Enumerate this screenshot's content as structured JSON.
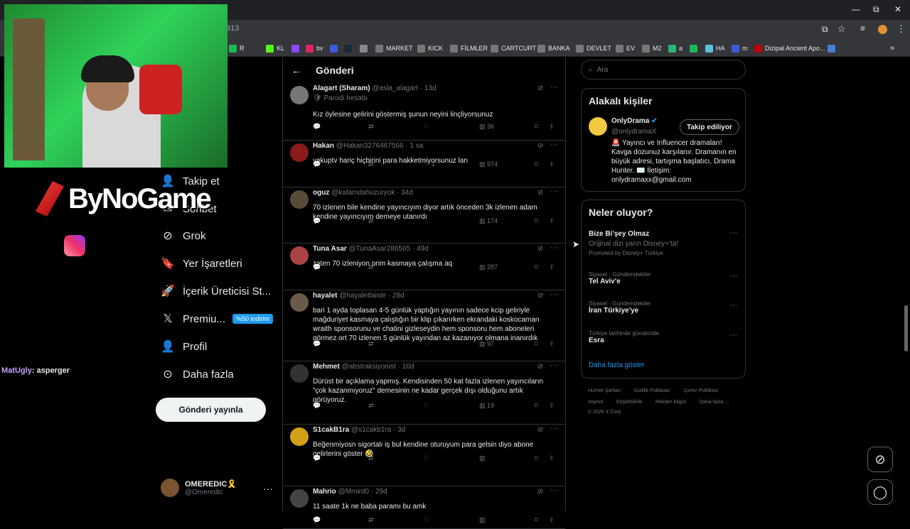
{
  "browser": {
    "url_fragment": "313",
    "bookmarks": [
      "R",
      "KL",
      "bv",
      "MARKET",
      "KICK",
      "FİLMLER",
      "CARTCURT",
      "BANKA",
      "DEVLET",
      "EV",
      "M2",
      "a",
      "HA",
      "m",
      "Dizipal Ancient Apo..."
    ],
    "more": "»",
    "win": {
      "min": "—",
      "max": "⧉",
      "close": "✕"
    }
  },
  "overlay": {
    "brand": "ByNoGame",
    "chat_user": "MatUgly",
    "chat_msg": ": asperger"
  },
  "nav": {
    "follow": "Takip et",
    "chat": "Sohbet",
    "grok": "Grok",
    "bookmarks": "Yer İşaretleri",
    "creator": "İçerik Üreticisi St...",
    "premium": "Premiu...",
    "premium_badge": "%50 indirim",
    "profile": "Profil",
    "more": "Daha fazla",
    "post": "Gönderi yayınla"
  },
  "me": {
    "name": "OMEREDIC🎗️",
    "handle": "@Omeredic",
    "more": "···"
  },
  "feed": {
    "back": "←",
    "title": "Gönderi",
    "tweets": [
      {
        "name": "Alagart (Sharam)",
        "handle": "@asla_alagart",
        "time": "· 13d",
        "sub": "🛡 Parodi hesabı",
        "text": "Kız öylesine gelirini göstermiş şunun neyini linçliyorsunuz",
        "likes": "",
        "views": "36",
        "color": "#777"
      },
      {
        "name": "Hakan",
        "handle": "@Hakan3276467566",
        "time": "· 1 sa",
        "sub": "",
        "text": "yakuptv hariç hiçbirini para hakketmiyorsunuz lan",
        "likes": "1",
        "views": "974",
        "color": "#8b1a1a"
      },
      {
        "name": "oguz",
        "handle": "@kafamdahuzuryok",
        "time": "· 34d",
        "sub": "",
        "text": "70 izlenen bile kendine yayıncıyım diyor artık önceden 3k izlenen adam kendine yayıncıyım demeye utanırdı",
        "likes": "",
        "views": "174",
        "color": "#5a4a3a"
      },
      {
        "name": "Tuna Asar",
        "handle": "@TunaAsar286565",
        "time": "· 49d",
        "sub": "",
        "text": "zaten 70 izleniyon prim kasmaya çalışma aq",
        "likes": "",
        "views": "287",
        "color": "#a44"
      },
      {
        "name": "hayalet",
        "handle": "@hayaletlaiste",
        "time": "· 28d",
        "sub": "",
        "text": "bari 1 ayda toplasan 4-5 günlük yaptığın yayının sadece kcip geliriyle mağduriyet kasmaya çalıştığın bir klip çıkarırken ekrandaki koskocaman wraith sponsorunu ve chatini gizleseydin hem sponsoru hem aboneleri görmez ort 70 izlenen 5 günlük yayından az kazanıyor olmana inanırdık",
        "likes": "",
        "views": "97",
        "color": "#6a5a4a"
      },
      {
        "name": "Mehmet",
        "handle": "@abstraksiyonist",
        "time": "· 10d",
        "sub": "",
        "text": "Dürüst bir açıklama yapmış. Kendisinden 50 kat fazla izlenen yayıncıların \"çok kazanmıyoruz\" demesinin ne kadar gerçek dışı olduğunu artık görüyoruz.",
        "likes": "",
        "views": "19",
        "color": "#333"
      },
      {
        "name": "S1cakB1ra",
        "handle": "@s1cakb1ra",
        "time": "· 3d",
        "sub": "",
        "text": "Beğenmiyosn sigortalı iş bul kendine oturuyum para gelsin diyo abone gelirlerini göster 🤣",
        "likes": "",
        "views": "",
        "color": "#d4a017"
      },
      {
        "name": "Mahrio",
        "handle": "@Mmird0",
        "time": "· 29d",
        "sub": "",
        "text": "11 saate 1k ne baba paramı bu amk",
        "likes": "",
        "views": "",
        "color": "#444"
      }
    ]
  },
  "right": {
    "search_placeholder": "Ara",
    "relevant_title": "Alakalı kişiler",
    "od_name": "OnlyDrama",
    "od_handle": "@onlydramaX",
    "od_follow": "Takip ediliyor",
    "od_bio": "🚨 Yayıncı ve Influencer dramaları! Kavga dozunuz karşılanır. Dramanın en büyük adresi, tartışma başlatıcı, Drama Hunter. ✉️ İletişim: onlydramaxx@gmail.com",
    "trends_title": "Neler oluyor?",
    "trends": [
      {
        "cat": "",
        "name": "Bize Bi'şey Olmaz",
        "desc": "Orijinal dizi yarın Disney+'ta!",
        "promo": "Promoted by Disney+ Türkiye"
      },
      {
        "cat": "Siyaset · Gündemdekiler",
        "name": "Tel Aviv'e",
        "desc": "",
        "promo": ""
      },
      {
        "cat": "Siyaset · Gündemdekiler",
        "name": "İran Türkiye'ye",
        "desc": "",
        "promo": ""
      },
      {
        "cat": "Türkiye tarihinde gündemde",
        "name": "Esra",
        "desc": "",
        "promo": ""
      }
    ],
    "show_more": "Daha fazla göster",
    "footer": [
      "Hizmet Şartları",
      "Gizlilik Politikası",
      "Çerez Politikası",
      "Imprint",
      "Erişilebilirlik",
      "Reklam bilgisi",
      "Daha fazla ...",
      "© 2026 X Corp."
    ]
  },
  "colors": {
    "accent": "#1d9bf0",
    "bg": "#000000",
    "border": "#2f3336",
    "muted": "#71767b"
  }
}
